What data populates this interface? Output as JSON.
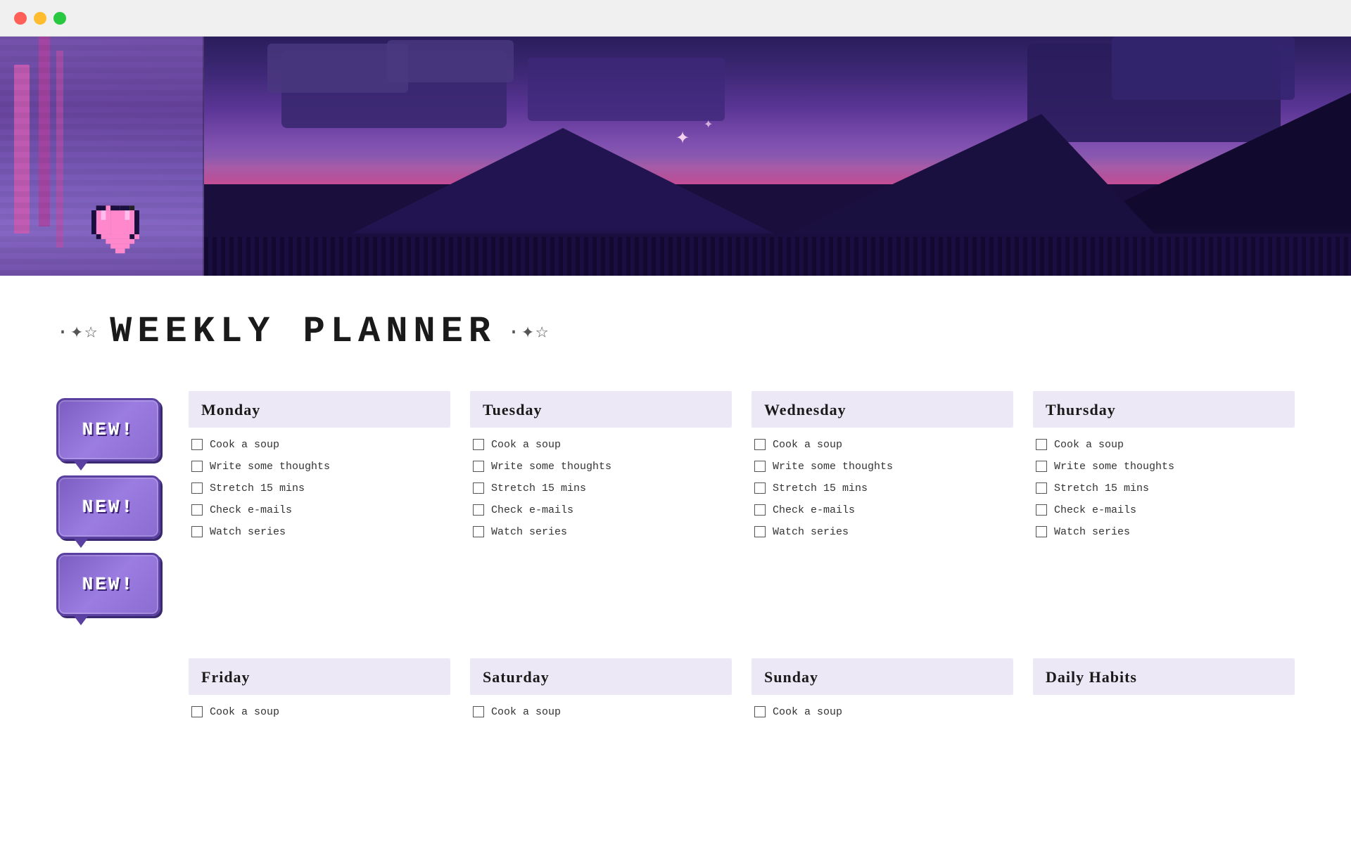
{
  "window": {
    "traffic_lights": [
      "close",
      "minimize",
      "maximize"
    ]
  },
  "hero": {
    "alt": "Pixel art purple sunset landscape with heart"
  },
  "title": {
    "prefix_deco": "·✦☆",
    "main": "WEEKLY  PLANNER",
    "suffix_deco": "·✦☆"
  },
  "stickers": [
    {
      "label": "NEW!"
    },
    {
      "label": "NEW!"
    },
    {
      "label": "NEW!"
    }
  ],
  "days_row1": [
    {
      "name": "Monday",
      "tasks": [
        "Cook a soup",
        "Write some thoughts",
        "Stretch 15 mins",
        "Check e-mails",
        "Watch series"
      ]
    },
    {
      "name": "Tuesday",
      "tasks": [
        "Cook a soup",
        "Write some thoughts",
        "Stretch 15 mins",
        "Check e-mails",
        "Watch series"
      ]
    },
    {
      "name": "Wednesday",
      "tasks": [
        "Cook a soup",
        "Write some thoughts",
        "Stretch 15 mins",
        "Check e-mails",
        "Watch series"
      ]
    },
    {
      "name": "Thursday",
      "tasks": [
        "Cook a soup",
        "Write some thoughts",
        "Stretch 15 mins",
        "Check e-mails",
        "Watch series"
      ]
    }
  ],
  "days_row2": [
    {
      "name": "Friday",
      "tasks": [
        "Cook a soup"
      ]
    },
    {
      "name": "Saturday",
      "tasks": [
        "Cook a soup"
      ]
    },
    {
      "name": "Sunday",
      "tasks": [
        "Cook a soup"
      ]
    },
    {
      "name": "Daily Habits",
      "tasks": []
    }
  ]
}
